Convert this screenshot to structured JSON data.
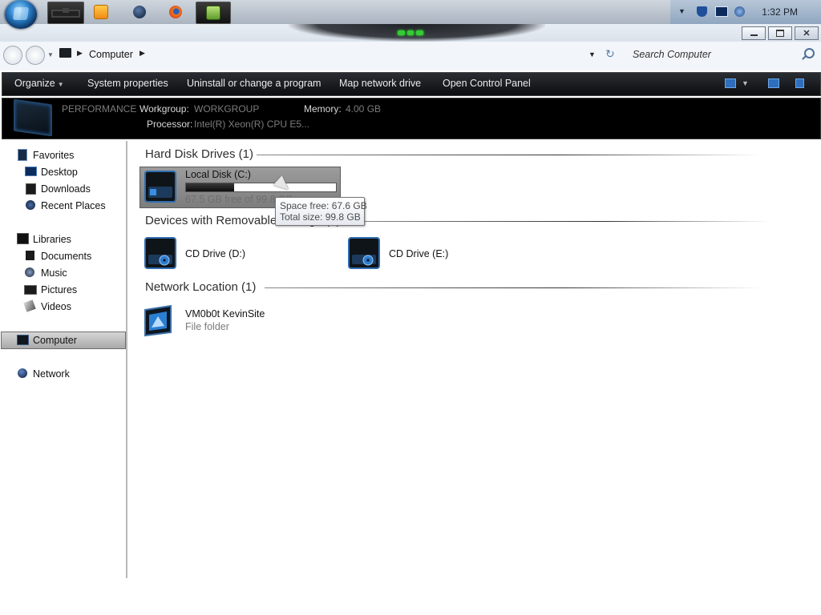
{
  "taskbar": {
    "start_icon": "windows-orb-icon",
    "pinned": [
      {
        "icon": "explorer-window-icon"
      },
      {
        "icon": "media-player-icon"
      },
      {
        "icon": "globe-icon"
      },
      {
        "icon": "firefox-icon"
      },
      {
        "icon": "control-panel-icon"
      }
    ],
    "tray_icons": [
      "show-hidden-icons-chevron",
      "security-shield-icon",
      "network-monitor-icon",
      "volume-icon"
    ],
    "clock": "1:32 PM"
  },
  "window": {
    "controls": [
      "minimize-button",
      "maximize-button",
      "close-button"
    ],
    "accent": "#33cc33"
  },
  "address": {
    "breadcrumb": [
      "Computer"
    ],
    "search_placeholder": "Search Computer"
  },
  "toolbar": {
    "organize": "Organize",
    "system_properties": "System properties",
    "uninstall": "Uninstall or change a program",
    "map_drive": "Map network drive",
    "control_panel": "Open Control Panel"
  },
  "details": {
    "name": "PERFORMANCE",
    "workgroup_label": "Workgroup:",
    "workgroup": "WORKGROUP",
    "memory_label": "Memory:",
    "memory": "4.00 GB",
    "processor_label": "Processor:",
    "processor": "Intel(R) Xeon(R) CPU E5..."
  },
  "nav": {
    "favorites": "Favorites",
    "desktop": "Desktop",
    "downloads": "Downloads",
    "recent": "Recent Places",
    "libraries": "Libraries",
    "documents": "Documents",
    "music": "Music",
    "pictures": "Pictures",
    "videos": "Videos",
    "computer": "Computer",
    "network": "Network",
    "selected": "Computer"
  },
  "groups": {
    "hdd": "Hard Disk Drives (1)",
    "removable": "Devices with Removable Storage (2)",
    "network": "Network Location (1)"
  },
  "drives": {
    "c": {
      "name": "Local Disk (C:)",
      "space": "67.5 GB free of 99.8 GB",
      "used_fraction": 0.32
    },
    "d": {
      "name": "CD Drive (D:)"
    },
    "e": {
      "name": "CD Drive (E:)"
    },
    "net": {
      "name": "VM0b0t KevinSite",
      "type": "File folder"
    }
  },
  "tooltip": {
    "free": "Space free: 67.6 GB",
    "total": "Total size: 99.8 GB"
  }
}
